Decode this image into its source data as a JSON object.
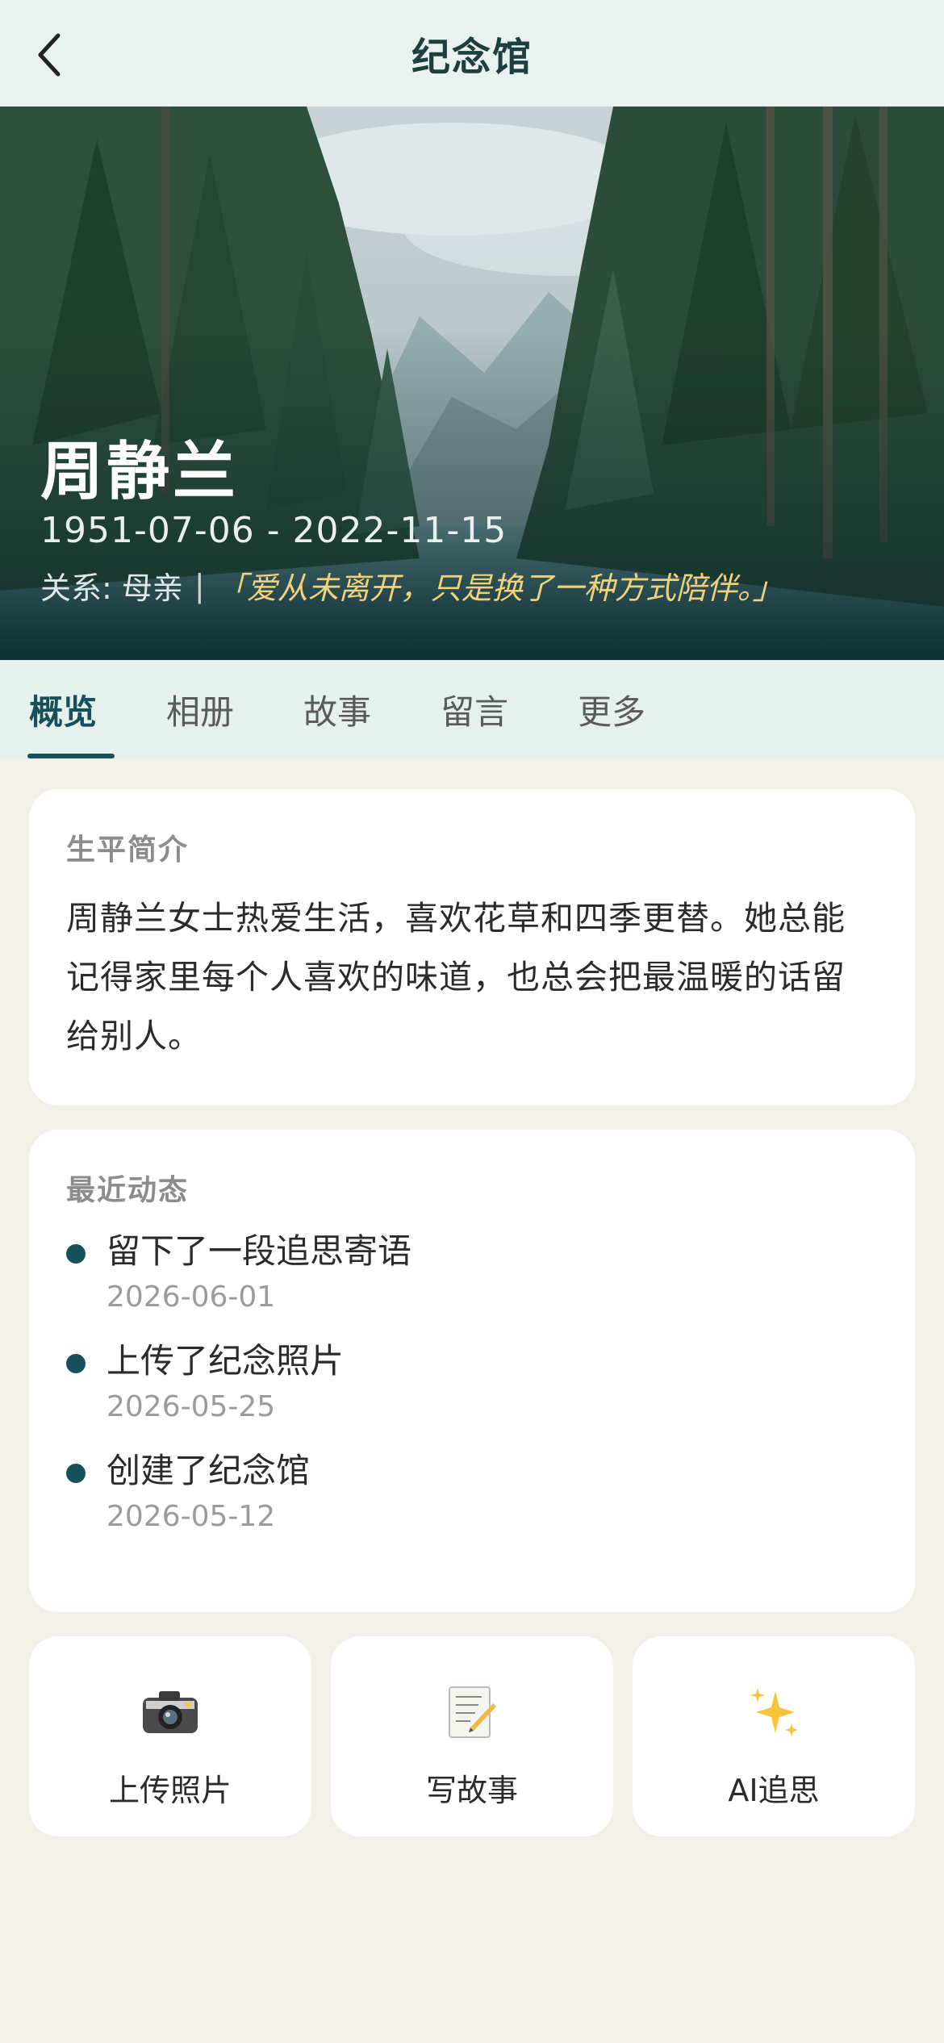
{
  "nav": {
    "title": "纪念馆",
    "back_icon": "chevron-left-icon"
  },
  "hero": {
    "name": "周静兰",
    "dates": "1951-07-06 - 2022-11-15",
    "relation": "关系: 母亲",
    "separator": "|",
    "quote": "「爱从未离开，只是换了一种方式陪伴。」",
    "quote_color": "#f1d27a"
  },
  "tabs": [
    {
      "label": "概览",
      "active": true
    },
    {
      "label": "相册",
      "active": false
    },
    {
      "label": "故事",
      "active": false
    },
    {
      "label": "留言",
      "active": false
    },
    {
      "label": "更多",
      "active": false
    }
  ],
  "bio": {
    "title": "生平简介",
    "text": "周静兰女士热爱生活，喜欢花草和四季更替。她总能记得家里每个人喜欢的味道，也总会把最温暖的话留给别人。"
  },
  "recent": {
    "title": "最近动态",
    "items": [
      {
        "text": "留下了一段追思寄语",
        "date": "2026-06-01"
      },
      {
        "text": "上传了纪念照片",
        "date": "2026-05-25"
      },
      {
        "text": "创建了纪念馆",
        "date": "2026-05-12"
      }
    ]
  },
  "actions": [
    {
      "label": "上传照片",
      "icon": "camera-icon"
    },
    {
      "label": "写故事",
      "icon": "memo-icon"
    },
    {
      "label": "AI追思",
      "icon": "sparkles-icon"
    }
  ],
  "colors": {
    "accent": "#17505a",
    "background": "#f3f0ea",
    "nav_bg": "#e9f2ef"
  }
}
